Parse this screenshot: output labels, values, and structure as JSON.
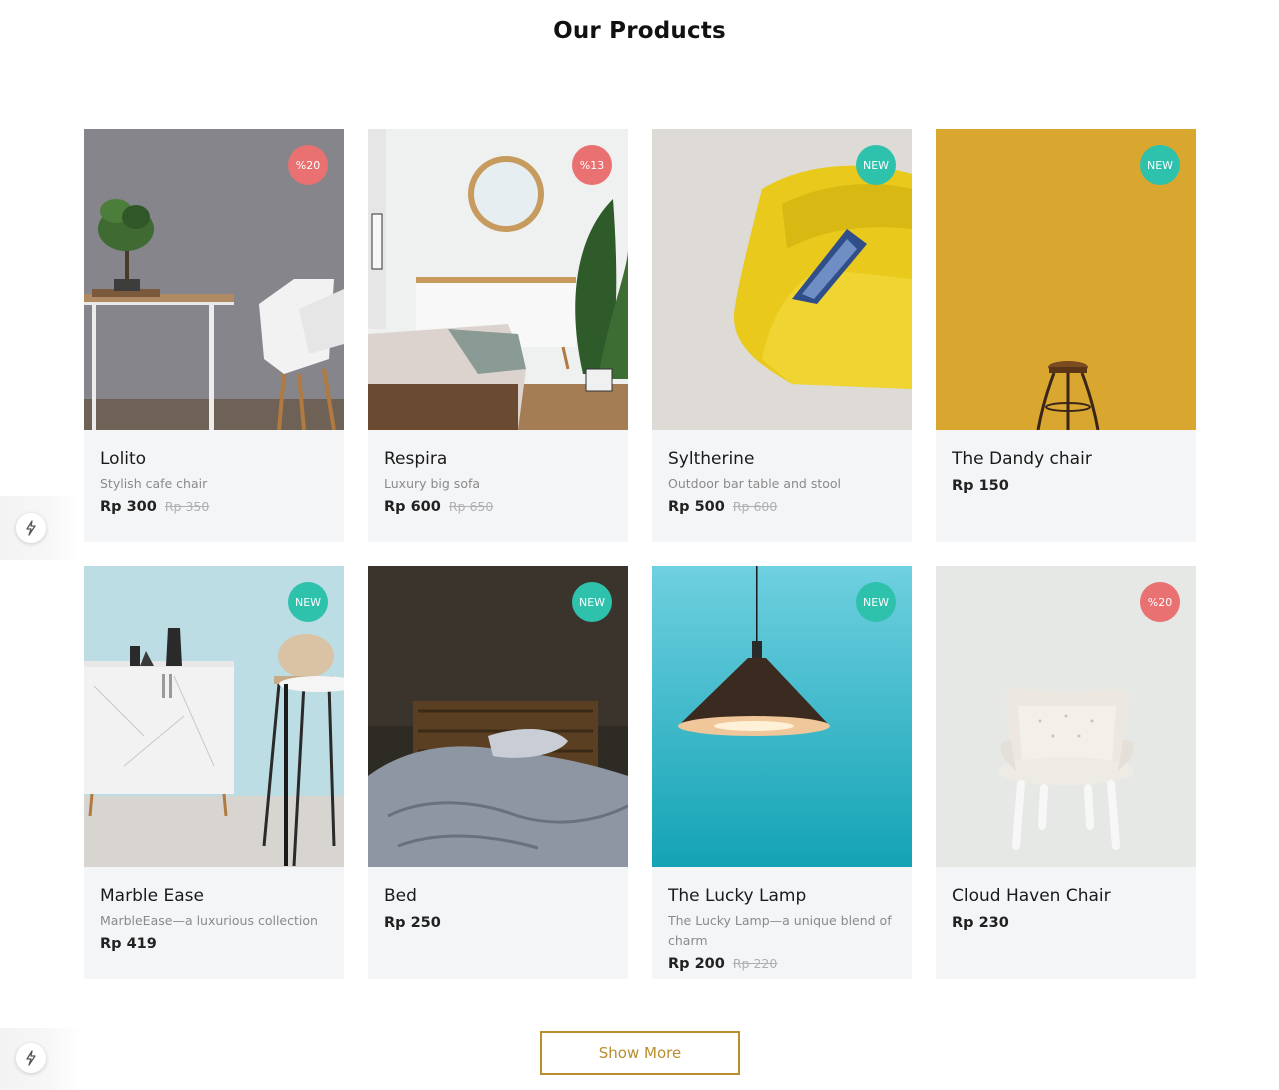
{
  "section_title": "Our Products",
  "products": [
    {
      "name": "Lolito",
      "description": "Stylish cafe chair",
      "price": "Rp 300",
      "old_price": "Rp 350",
      "badge": "%20",
      "badge_type": "discount"
    },
    {
      "name": "Respira",
      "description": "Luxury big sofa",
      "price": "Rp 600",
      "old_price": "Rp 650",
      "badge": "%13",
      "badge_type": "discount"
    },
    {
      "name": "Syltherine",
      "description": "Outdoor bar table and stool",
      "price": "Rp 500",
      "old_price": "Rp 600",
      "badge": "NEW",
      "badge_type": "new"
    },
    {
      "name": "The Dandy chair",
      "description": "",
      "price": "Rp 150",
      "old_price": "",
      "badge": "NEW",
      "badge_type": "new"
    },
    {
      "name": "Marble Ease",
      "description": "MarbleEase—a luxurious collection",
      "price": "Rp 419",
      "old_price": "",
      "badge": "NEW",
      "badge_type": "new"
    },
    {
      "name": "Bed",
      "description": "",
      "price": "Rp 250",
      "old_price": "",
      "badge": "NEW",
      "badge_type": "new"
    },
    {
      "name": "The Lucky Lamp",
      "description": "The Lucky Lamp—a unique blend of charm",
      "price": "Rp 200",
      "old_price": "Rp 220",
      "badge": "NEW",
      "badge_type": "new"
    },
    {
      "name": "Cloud Haven Chair",
      "description": "",
      "price": "Rp 230",
      "old_price": "",
      "badge": "%20",
      "badge_type": "discount"
    }
  ],
  "show_more_label": "Show More",
  "colors": {
    "accent": "#b88e2f",
    "discount_badge": "#e97171",
    "new_badge": "#2ec1ac",
    "card_bg": "#f4f5f7"
  },
  "icons": {
    "side_widget": "lightning-bolt-icon"
  }
}
